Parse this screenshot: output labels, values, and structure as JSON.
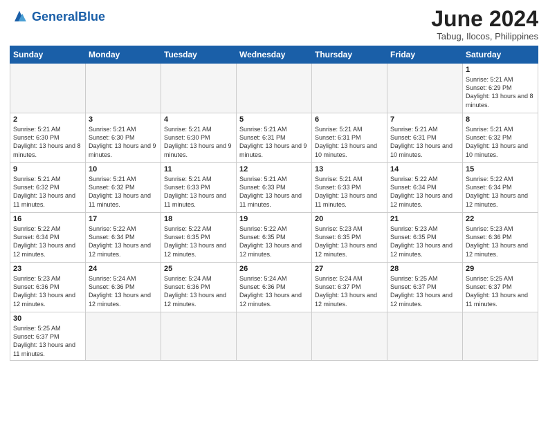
{
  "header": {
    "logo_general": "General",
    "logo_blue": "Blue",
    "month_title": "June 2024",
    "subtitle": "Tabug, Ilocos, Philippines"
  },
  "weekdays": [
    "Sunday",
    "Monday",
    "Tuesday",
    "Wednesday",
    "Thursday",
    "Friday",
    "Saturday"
  ],
  "weeks": [
    [
      {
        "day": "",
        "info": "",
        "empty": true
      },
      {
        "day": "",
        "info": "",
        "empty": true
      },
      {
        "day": "",
        "info": "",
        "empty": true
      },
      {
        "day": "",
        "info": "",
        "empty": true
      },
      {
        "day": "",
        "info": "",
        "empty": true
      },
      {
        "day": "",
        "info": "",
        "empty": true
      },
      {
        "day": "1",
        "info": "Sunrise: 5:21 AM\nSunset: 6:29 PM\nDaylight: 13 hours\nand 8 minutes."
      }
    ],
    [
      {
        "day": "2",
        "info": "Sunrise: 5:21 AM\nSunset: 6:30 PM\nDaylight: 13 hours\nand 8 minutes."
      },
      {
        "day": "3",
        "info": "Sunrise: 5:21 AM\nSunset: 6:30 PM\nDaylight: 13 hours\nand 9 minutes."
      },
      {
        "day": "4",
        "info": "Sunrise: 5:21 AM\nSunset: 6:30 PM\nDaylight: 13 hours\nand 9 minutes."
      },
      {
        "day": "5",
        "info": "Sunrise: 5:21 AM\nSunset: 6:31 PM\nDaylight: 13 hours\nand 9 minutes."
      },
      {
        "day": "6",
        "info": "Sunrise: 5:21 AM\nSunset: 6:31 PM\nDaylight: 13 hours\nand 10 minutes."
      },
      {
        "day": "7",
        "info": "Sunrise: 5:21 AM\nSunset: 6:31 PM\nDaylight: 13 hours\nand 10 minutes."
      },
      {
        "day": "8",
        "info": "Sunrise: 5:21 AM\nSunset: 6:32 PM\nDaylight: 13 hours\nand 10 minutes."
      }
    ],
    [
      {
        "day": "9",
        "info": "Sunrise: 5:21 AM\nSunset: 6:32 PM\nDaylight: 13 hours\nand 11 minutes."
      },
      {
        "day": "10",
        "info": "Sunrise: 5:21 AM\nSunset: 6:32 PM\nDaylight: 13 hours\nand 11 minutes."
      },
      {
        "day": "11",
        "info": "Sunrise: 5:21 AM\nSunset: 6:33 PM\nDaylight: 13 hours\nand 11 minutes."
      },
      {
        "day": "12",
        "info": "Sunrise: 5:21 AM\nSunset: 6:33 PM\nDaylight: 13 hours\nand 11 minutes."
      },
      {
        "day": "13",
        "info": "Sunrise: 5:21 AM\nSunset: 6:33 PM\nDaylight: 13 hours\nand 11 minutes."
      },
      {
        "day": "14",
        "info": "Sunrise: 5:22 AM\nSunset: 6:34 PM\nDaylight: 13 hours\nand 12 minutes."
      },
      {
        "day": "15",
        "info": "Sunrise: 5:22 AM\nSunset: 6:34 PM\nDaylight: 13 hours\nand 12 minutes."
      }
    ],
    [
      {
        "day": "16",
        "info": "Sunrise: 5:22 AM\nSunset: 6:34 PM\nDaylight: 13 hours\nand 12 minutes."
      },
      {
        "day": "17",
        "info": "Sunrise: 5:22 AM\nSunset: 6:34 PM\nDaylight: 13 hours\nand 12 minutes."
      },
      {
        "day": "18",
        "info": "Sunrise: 5:22 AM\nSunset: 6:35 PM\nDaylight: 13 hours\nand 12 minutes."
      },
      {
        "day": "19",
        "info": "Sunrise: 5:22 AM\nSunset: 6:35 PM\nDaylight: 13 hours\nand 12 minutes."
      },
      {
        "day": "20",
        "info": "Sunrise: 5:23 AM\nSunset: 6:35 PM\nDaylight: 13 hours\nand 12 minutes."
      },
      {
        "day": "21",
        "info": "Sunrise: 5:23 AM\nSunset: 6:35 PM\nDaylight: 13 hours\nand 12 minutes."
      },
      {
        "day": "22",
        "info": "Sunrise: 5:23 AM\nSunset: 6:36 PM\nDaylight: 13 hours\nand 12 minutes."
      }
    ],
    [
      {
        "day": "23",
        "info": "Sunrise: 5:23 AM\nSunset: 6:36 PM\nDaylight: 13 hours\nand 12 minutes."
      },
      {
        "day": "24",
        "info": "Sunrise: 5:24 AM\nSunset: 6:36 PM\nDaylight: 13 hours\nand 12 minutes."
      },
      {
        "day": "25",
        "info": "Sunrise: 5:24 AM\nSunset: 6:36 PM\nDaylight: 13 hours\nand 12 minutes."
      },
      {
        "day": "26",
        "info": "Sunrise: 5:24 AM\nSunset: 6:36 PM\nDaylight: 13 hours\nand 12 minutes."
      },
      {
        "day": "27",
        "info": "Sunrise: 5:24 AM\nSunset: 6:37 PM\nDaylight: 13 hours\nand 12 minutes."
      },
      {
        "day": "28",
        "info": "Sunrise: 5:25 AM\nSunset: 6:37 PM\nDaylight: 13 hours\nand 12 minutes."
      },
      {
        "day": "29",
        "info": "Sunrise: 5:25 AM\nSunset: 6:37 PM\nDaylight: 13 hours\nand 11 minutes."
      }
    ],
    [
      {
        "day": "30",
        "info": "Sunrise: 5:25 AM\nSunset: 6:37 PM\nDaylight: 13 hours\nand 11 minutes.",
        "last": true
      },
      {
        "day": "",
        "info": "",
        "empty": true,
        "last": true
      },
      {
        "day": "",
        "info": "",
        "empty": true,
        "last": true
      },
      {
        "day": "",
        "info": "",
        "empty": true,
        "last": true
      },
      {
        "day": "",
        "info": "",
        "empty": true,
        "last": true
      },
      {
        "day": "",
        "info": "",
        "empty": true,
        "last": true
      },
      {
        "day": "",
        "info": "",
        "empty": true,
        "last": true
      }
    ]
  ]
}
